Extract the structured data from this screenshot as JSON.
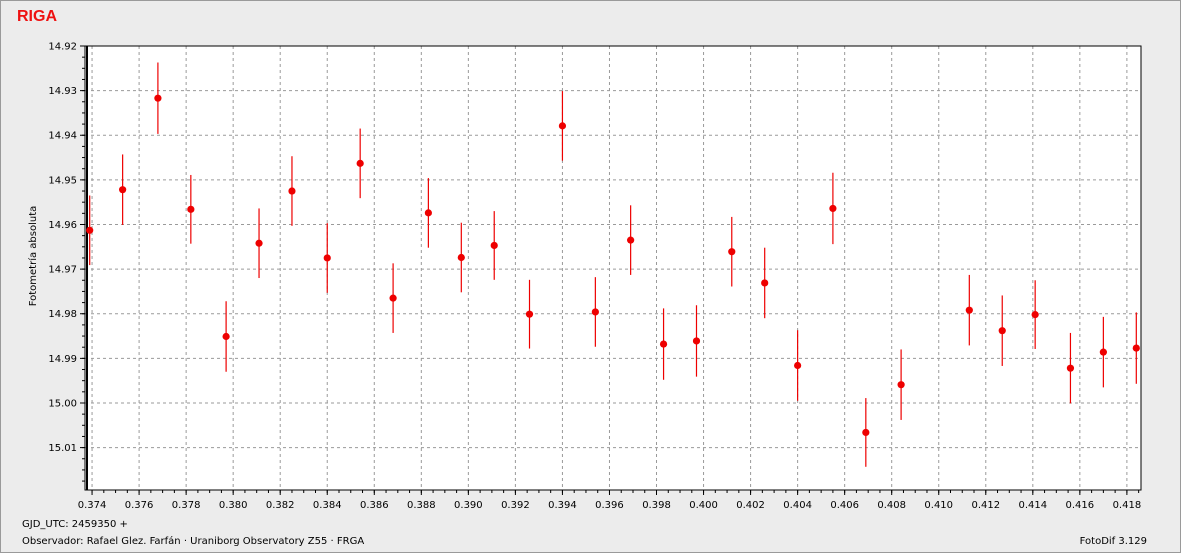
{
  "title": "RIGA",
  "footer": {
    "gjd": "GJD_UTC: 2459350 +",
    "observer": "Observador: Rafael Glez. Farfán · Uraniborg Observatory Z55 · FRGA",
    "version": "FotoDif 3.129"
  },
  "colors": {
    "points": "#ee0000",
    "title": "#ee1111",
    "plot_bg": "#ffffff",
    "window_bg": "#ececec"
  },
  "chart_data": {
    "type": "scatter",
    "title": "RIGA",
    "xlabel": "",
    "ylabel": "Fotometría absoluta",
    "xlim": [
      0.3737,
      0.4186
    ],
    "ylim": [
      14.92,
      15.0195
    ],
    "y_inverted": true,
    "grid": true,
    "x_ticks": [
      "0.374",
      "0.376",
      "0.378",
      "0.380",
      "0.382",
      "0.384",
      "0.386",
      "0.388",
      "0.390",
      "0.392",
      "0.394",
      "0.396",
      "0.398",
      "0.400",
      "0.402",
      "0.404",
      "0.406",
      "0.408",
      "0.410",
      "0.412",
      "0.414",
      "0.416",
      "0.418"
    ],
    "y_ticks": [
      "14.92",
      "14.93",
      "14.94",
      "14.95",
      "14.96",
      "14.97",
      "14.98",
      "14.99",
      "15.00",
      "15.01"
    ],
    "error_bars": true,
    "points": [
      {
        "x": 0.3739,
        "y": 14.9613,
        "err": 0.0078
      },
      {
        "x": 0.3753,
        "y": 14.9522,
        "err": 0.0079
      },
      {
        "x": 0.3768,
        "y": 14.9317,
        "err": 0.008
      },
      {
        "x": 0.3782,
        "y": 14.9566,
        "err": 0.0077
      },
      {
        "x": 0.3797,
        "y": 14.9851,
        "err": 0.0079
      },
      {
        "x": 0.3811,
        "y": 14.9642,
        "err": 0.0078
      },
      {
        "x": 0.3825,
        "y": 14.9525,
        "err": 0.0078
      },
      {
        "x": 0.384,
        "y": 14.9675,
        "err": 0.0078
      },
      {
        "x": 0.3854,
        "y": 14.9463,
        "err": 0.0078
      },
      {
        "x": 0.3868,
        "y": 14.9765,
        "err": 0.0078
      },
      {
        "x": 0.3883,
        "y": 14.9574,
        "err": 0.0078
      },
      {
        "x": 0.3897,
        "y": 14.9674,
        "err": 0.0078
      },
      {
        "x": 0.3911,
        "y": 14.9647,
        "err": 0.0077
      },
      {
        "x": 0.3926,
        "y": 14.9801,
        "err": 0.0077
      },
      {
        "x": 0.394,
        "y": 14.9379,
        "err": 0.0078
      },
      {
        "x": 0.3954,
        "y": 14.9796,
        "err": 0.0078
      },
      {
        "x": 0.3969,
        "y": 14.9635,
        "err": 0.0078
      },
      {
        "x": 0.3983,
        "y": 14.9868,
        "err": 0.008
      },
      {
        "x": 0.3997,
        "y": 14.9861,
        "err": 0.008
      },
      {
        "x": 0.4012,
        "y": 14.9661,
        "err": 0.0078
      },
      {
        "x": 0.4026,
        "y": 14.9731,
        "err": 0.0079
      },
      {
        "x": 0.404,
        "y": 14.9916,
        "err": 0.0079
      },
      {
        "x": 0.4055,
        "y": 14.9564,
        "err": 0.008
      },
      {
        "x": 0.4069,
        "y": 15.0066,
        "err": 0.0077
      },
      {
        "x": 0.4084,
        "y": 14.9959,
        "err": 0.0079
      },
      {
        "x": 0.4113,
        "y": 14.9792,
        "err": 0.0079
      },
      {
        "x": 0.4127,
        "y": 14.9838,
        "err": 0.0079
      },
      {
        "x": 0.4141,
        "y": 14.9802,
        "err": 0.0077
      },
      {
        "x": 0.4156,
        "y": 14.9922,
        "err": 0.0079
      },
      {
        "x": 0.417,
        "y": 14.9886,
        "err": 0.0079
      },
      {
        "x": 0.4184,
        "y": 14.9877,
        "err": 0.008
      }
    ]
  }
}
